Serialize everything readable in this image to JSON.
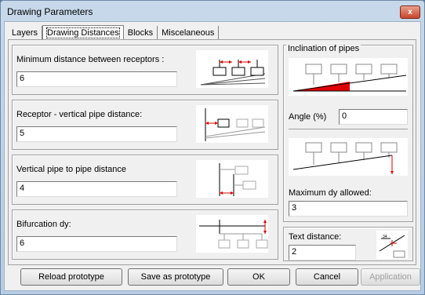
{
  "window": {
    "title": "Drawing Parameters",
    "close_label": "x"
  },
  "tabs": [
    "Layers",
    "Drawing Distances",
    "Blocks",
    "Miscelaneous"
  ],
  "left": {
    "min_distance": {
      "label": "Minimum distance between receptors :",
      "value": "6"
    },
    "receptor_pipe": {
      "label": "Receptor - vertical pipe distance:",
      "value": "5"
    },
    "vpipe_pipe": {
      "label": "Vertical pipe to pipe distance",
      "value": "4"
    },
    "bifurcation": {
      "label": "Bifurcation dy:",
      "value": "6"
    }
  },
  "right": {
    "inclination_title": "Inclination of pipes",
    "angle_label": "Angle (%)",
    "angle_value": "0",
    "max_dy_label": "Maximum dy allowed:",
    "max_dy_value": "3",
    "text_distance_label": "Text distance:",
    "text_distance_value": "2"
  },
  "buttons": {
    "reload": "Reload prototype",
    "save": "Save as prototype",
    "ok": "OK",
    "cancel": "Cancel",
    "application": "Application"
  },
  "colors": {
    "accent_red": "#e00000",
    "frame": "#a0a0a0"
  }
}
